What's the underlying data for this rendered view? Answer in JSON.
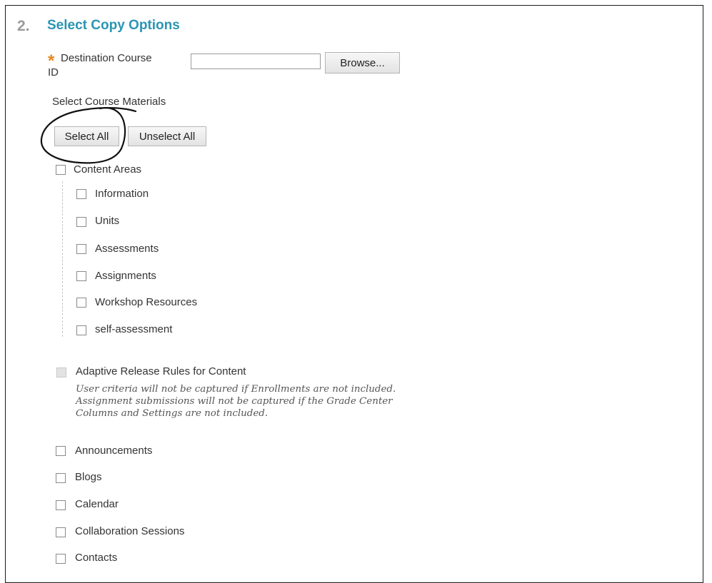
{
  "section": {
    "step_number": "2.",
    "title": "Select Copy Options"
  },
  "destination": {
    "label_line1": "Destination Course",
    "label_line2": "ID",
    "required_mark": "*",
    "value": "",
    "browse_label": "Browse..."
  },
  "materials": {
    "label": "Select Course Materials",
    "select_all_label": "Select All",
    "unselect_all_label": "Unselect All",
    "content_areas": {
      "label": "Content Areas",
      "checked": false,
      "children": [
        {
          "label": "Information",
          "checked": false
        },
        {
          "label": "Units",
          "checked": false
        },
        {
          "label": "Assessments",
          "checked": false
        },
        {
          "label": "Assignments",
          "checked": false
        },
        {
          "label": "Workshop Resources",
          "checked": false
        },
        {
          "label": "self-assessment",
          "checked": false
        }
      ]
    },
    "adaptive_release": {
      "label": "Adaptive Release Rules for Content",
      "disabled": true,
      "note": "User criteria will not be captured if Enrollments are not included. Assignment submissions will not be captured if the Grade Center Columns and Settings are not included."
    },
    "other_items": [
      {
        "label": "Announcements",
        "checked": false
      },
      {
        "label": "Blogs",
        "checked": false
      },
      {
        "label": "Calendar",
        "checked": false
      },
      {
        "label": "Collaboration Sessions",
        "checked": false
      },
      {
        "label": "Contacts",
        "checked": false
      }
    ]
  },
  "colors": {
    "title": "#2a95b4",
    "step_number": "#9a9a9a",
    "required": "#e8871e",
    "annotation_ink": "#111111"
  },
  "annotation": {
    "shape": "hand-drawn-circle",
    "target": "select-all-button"
  }
}
